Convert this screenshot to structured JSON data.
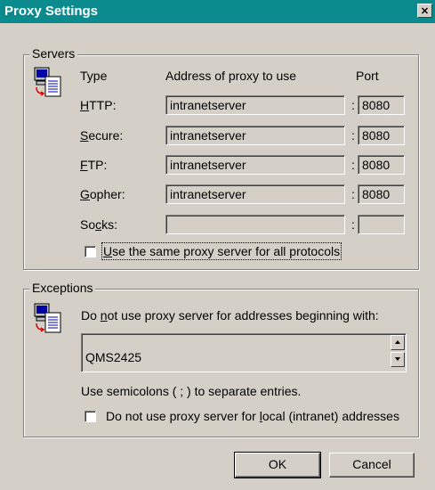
{
  "window": {
    "title": "Proxy Settings",
    "close_glyph": "✕"
  },
  "servers": {
    "legend": "Servers",
    "icon": "proxy-servers-icon",
    "headers": {
      "type": "Type",
      "address": "Address of proxy to use",
      "port": "Port"
    },
    "rows": [
      {
        "label": "HTTP:",
        "mnemonic": "H",
        "rest": "TTP:",
        "address": "intranetserver",
        "port": "8080"
      },
      {
        "label": "Secure:",
        "mnemonic": "S",
        "rest": "ecure:",
        "address": "intranetserver",
        "port": "8080"
      },
      {
        "label": "FTP:",
        "mnemonic": "F",
        "rest": "TP:",
        "address": "intranetserver",
        "port": "8080"
      },
      {
        "label": "Gopher:",
        "mnemonic": "G",
        "rest": "opher:",
        "address": "intranetserver",
        "port": "8080"
      },
      {
        "label": "Socks:",
        "pre": "So",
        "mnemonic": "c",
        "rest": "ks:",
        "address": "",
        "port": ""
      }
    ],
    "same_proxy": {
      "pre": "",
      "mnemonic": "U",
      "rest": "se the same proxy server for all protocols",
      "checked": false
    }
  },
  "exceptions": {
    "legend": "Exceptions",
    "icon": "exceptions-icon",
    "prompt": {
      "pre": "Do ",
      "mnemonic": "n",
      "rest": "ot use proxy server for addresses beginning with:"
    },
    "list_value": "QMS2425",
    "hint": "Use semicolons ( ; ) to separate entries.",
    "local": {
      "pre": "Do not use proxy server for ",
      "mnemonic": "l",
      "rest": "ocal (intranet) addresses",
      "checked": false
    }
  },
  "buttons": {
    "ok": "OK",
    "cancel": "Cancel"
  }
}
